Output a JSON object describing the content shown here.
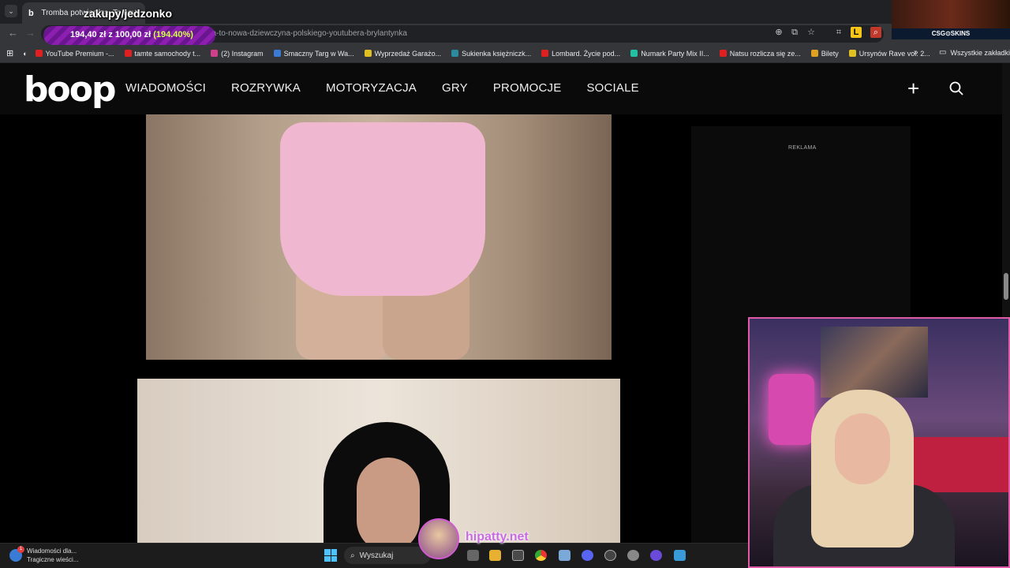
{
  "browser": {
    "tab": {
      "title": "Tromba potwierdza. To nowa d",
      "favicon": "b"
    },
    "url": "dza-to-nowa-dziewczyna-polskiego-youtubera-brylantynka",
    "bookmarks": [
      {
        "label": "YouTube Premium -...",
        "color": "#e02020"
      },
      {
        "label": "tamte samochody t...",
        "color": "#e02020"
      },
      {
        "label": "(2) Instagram",
        "color": "#d0408a"
      },
      {
        "label": "Smaczny Targ w Wa...",
        "color": "#3a7bd5"
      },
      {
        "label": "Wyprzedaż Garażo...",
        "color": "#e0c020"
      },
      {
        "label": "Sukienka księżniczk...",
        "color": "#2a8aa0"
      },
      {
        "label": "Lombard. Życie pod...",
        "color": "#e02020"
      },
      {
        "label": "Numark Party Mix II...",
        "color": "#20c0a0"
      },
      {
        "label": "Natsu rozlicza się ze...",
        "color": "#e02020"
      },
      {
        "label": "Bilety",
        "color": "#e0a020"
      },
      {
        "label": "Ursynów Rave vol. 2...",
        "color": "#e0c020"
      }
    ],
    "bookmarks_more": "»",
    "bookmarks_all": "Wszystkie zakładki"
  },
  "stream": {
    "overlay_title": "zakupy/jedzonko",
    "donation": {
      "amount": "194,40 zł z 100,00 zł",
      "percent": "(194.40%)"
    },
    "csgo_badge": "CSG⊙SKINS",
    "hipatty": "hipatty.net"
  },
  "site": {
    "logo": "boop",
    "nav": [
      "WIADOMOŚCI",
      "ROZRYWKA",
      "MOTORYZACJA",
      "GRY",
      "PROMOCJE",
      "SOCIALE"
    ],
    "ad_label": "REKLAMA"
  },
  "taskbar": {
    "news_title": "Wiadomości dla...",
    "news_subtitle": "Tragiczne wieści...",
    "news_badge": "1",
    "search_label": "Wyszukaj"
  },
  "icons": [
    "plus-icon",
    "search-icon",
    "star-icon",
    "zoom-icon",
    "windows-start-icon"
  ]
}
